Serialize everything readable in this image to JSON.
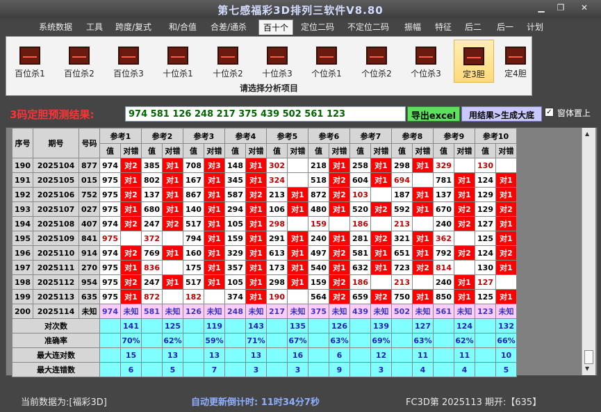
{
  "window": {
    "title": "第七感福彩3D排列三软件V8.80",
    "min": "▁",
    "max": "❐",
    "close": "✕"
  },
  "menu": [
    "系统数据",
    "工具",
    "跨度/复式",
    "和/合值",
    "合差/通杀",
    "百十个",
    "定位二码",
    "不定位二码",
    "振幅",
    "特征",
    "后二",
    "后一",
    "计划"
  ],
  "ribbon": {
    "buttons": [
      "百位杀1",
      "百位杀2",
      "百位杀3",
      "十位杀1",
      "十位杀2",
      "十位杀3",
      "个位杀1",
      "个位杀2",
      "个位杀3",
      "定3胆",
      "定4胆"
    ],
    "caption": "请选择分析项目"
  },
  "predict": {
    "label": "3码定胆预测结果:",
    "result": "974 581 126 248 217 375 439 502 561 123",
    "export_btn": "导出excel",
    "gen_btn": "用结果>生成大底",
    "check": "✓",
    "check_label": "窗体置上"
  },
  "table": {
    "h_seq": "序号",
    "h_period": "期号",
    "h_code": "号码",
    "refs": [
      "参考1",
      "参考2",
      "参考3",
      "参考4",
      "参考5",
      "参考6",
      "参考7",
      "参考8",
      "参考9",
      "参考10"
    ],
    "h_val": "值",
    "h_mark": "对错",
    "rows": [
      {
        "seq": "190",
        "period": "2025104",
        "code": "877",
        "cells": [
          [
            "974",
            "对2"
          ],
          [
            "385",
            "对1"
          ],
          [
            "708",
            "对3"
          ],
          [
            "148",
            "对1"
          ],
          [
            "302",
            ""
          ],
          [
            "218",
            "对1"
          ],
          [
            "258",
            "对1"
          ],
          [
            "298",
            "对1"
          ],
          [
            "329",
            ""
          ],
          [
            "130",
            ""
          ]
        ]
      },
      {
        "seq": "191",
        "period": "2025105",
        "code": "015",
        "cells": [
          [
            "975",
            "对1"
          ],
          [
            "802",
            "对1"
          ],
          [
            "167",
            "对1"
          ],
          [
            "345",
            "对1"
          ],
          [
            "324",
            ""
          ],
          [
            "518",
            "对2"
          ],
          [
            "604",
            "对1"
          ],
          [
            "694",
            ""
          ],
          [
            "781",
            "对1"
          ],
          [
            "124",
            "对1"
          ]
        ]
      },
      {
        "seq": "192",
        "period": "2025106",
        "code": "752",
        "cells": [
          [
            "975",
            "对2"
          ],
          [
            "137",
            "对1"
          ],
          [
            "867",
            "对1"
          ],
          [
            "587",
            "对2"
          ],
          [
            "213",
            "对1"
          ],
          [
            "872",
            "对2"
          ],
          [
            "103",
            ""
          ],
          [
            "187",
            "对1"
          ],
          [
            "137",
            "对1"
          ],
          [
            "129",
            "对1"
          ]
        ]
      },
      {
        "seq": "193",
        "period": "2025107",
        "code": "027",
        "cells": [
          [
            "975",
            "对1"
          ],
          [
            "680",
            "对1"
          ],
          [
            "140",
            "对1"
          ],
          [
            "294",
            "对1"
          ],
          [
            "106",
            "对1"
          ],
          [
            "480",
            "对1"
          ],
          [
            "520",
            "对2"
          ],
          [
            "592",
            "对1"
          ],
          [
            "670",
            "对2"
          ],
          [
            "129",
            "对2"
          ]
        ]
      },
      {
        "seq": "194",
        "period": "2025108",
        "code": "407",
        "cells": [
          [
            "974",
            "对2"
          ],
          [
            "247",
            "对2"
          ],
          [
            "517",
            "对1"
          ],
          [
            "105",
            "对1"
          ],
          [
            "298",
            ""
          ],
          [
            "159",
            ""
          ],
          [
            "186",
            ""
          ],
          [
            "213",
            ""
          ],
          [
            "240",
            "对2"
          ],
          [
            "127",
            "对1"
          ]
        ]
      },
      {
        "seq": "195",
        "period": "2025109",
        "code": "841",
        "cells": [
          [
            "975",
            ""
          ],
          [
            "372",
            ""
          ],
          [
            "794",
            "对1"
          ],
          [
            "159",
            "对1"
          ],
          [
            "291",
            "对1"
          ],
          [
            "240",
            "对1"
          ],
          [
            "281",
            "对2"
          ],
          [
            "321",
            "对1"
          ],
          [
            "362",
            ""
          ],
          [
            "125",
            "对1"
          ]
        ]
      },
      {
        "seq": "196",
        "period": "2025110",
        "code": "914",
        "cells": [
          [
            "974",
            "对2"
          ],
          [
            "769",
            "对1"
          ],
          [
            "160",
            "对1"
          ],
          [
            "329",
            "对1"
          ],
          [
            "613",
            "对1"
          ],
          [
            "497",
            "对2"
          ],
          [
            "581",
            "对1"
          ],
          [
            "651",
            "对1"
          ],
          [
            "792",
            "对2"
          ],
          [
            "124",
            "对2"
          ]
        ]
      },
      {
        "seq": "197",
        "period": "2025111",
        "code": "270",
        "cells": [
          [
            "975",
            "对1"
          ],
          [
            "836",
            ""
          ],
          [
            "175",
            "对1"
          ],
          [
            "357",
            "对1"
          ],
          [
            "173",
            "对1"
          ],
          [
            "540",
            "对1"
          ],
          [
            "632",
            "对1"
          ],
          [
            "723",
            "对2"
          ],
          [
            "814",
            ""
          ],
          [
            "130",
            "对1"
          ]
        ]
      },
      {
        "seq": "198",
        "period": "2025112",
        "code": "954",
        "cells": [
          [
            "975",
            "对2"
          ],
          [
            "247",
            "对1"
          ],
          [
            "517",
            "对1"
          ],
          [
            "105",
            "对1"
          ],
          [
            "298",
            "对1"
          ],
          [
            "159",
            "对2"
          ],
          [
            "186",
            ""
          ],
          [
            "213",
            ""
          ],
          [
            "240",
            "对1"
          ],
          [
            "127",
            ""
          ]
        ]
      },
      {
        "seq": "199",
        "period": "2025113",
        "code": "635",
        "cells": [
          [
            "975",
            "对1"
          ],
          [
            "872",
            ""
          ],
          [
            "182",
            ""
          ],
          [
            "374",
            "对1"
          ],
          [
            "190",
            ""
          ],
          [
            "564",
            "对2"
          ],
          [
            "659",
            "对2"
          ],
          [
            "750",
            "对1"
          ],
          [
            "850",
            "对1"
          ],
          [
            "125",
            "对1"
          ]
        ]
      }
    ],
    "last": {
      "seq": "200",
      "period": "2025114",
      "code": "未知",
      "cells": [
        [
          "974",
          "未知"
        ],
        [
          "581",
          "未知"
        ],
        [
          "126",
          "未知"
        ],
        [
          "248",
          "未知"
        ],
        [
          "217",
          "未知"
        ],
        [
          "375",
          "未知"
        ],
        [
          "439",
          "未知"
        ],
        [
          "502",
          "未知"
        ],
        [
          "561",
          "未知"
        ],
        [
          "123",
          "未知"
        ]
      ]
    },
    "stats": [
      {
        "label": "对次数",
        "values": [
          "141",
          "125",
          "119",
          "143",
          "135",
          "126",
          "139",
          "127",
          "124",
          "132"
        ]
      },
      {
        "label": "准确率",
        "values": [
          "70%",
          "62%",
          "59%",
          "71%",
          "67%",
          "63%",
          "69%",
          "63%",
          "62%",
          "66%"
        ]
      },
      {
        "label": "最大连对数",
        "values": [
          "15",
          "13",
          "13",
          "13",
          "16",
          "6",
          "12",
          "11",
          "11",
          "10"
        ]
      },
      {
        "label": "最大连错数",
        "values": [
          "6",
          "5",
          "7",
          "3",
          "3",
          "9",
          "3",
          "4",
          "4",
          "5"
        ]
      }
    ]
  },
  "status": {
    "current": "当前数据为:[福彩3D]",
    "countdown": "自动更新倒计时: 11时34分7秒",
    "draw": "FC3D第 2025113 期开:【635】"
  }
}
